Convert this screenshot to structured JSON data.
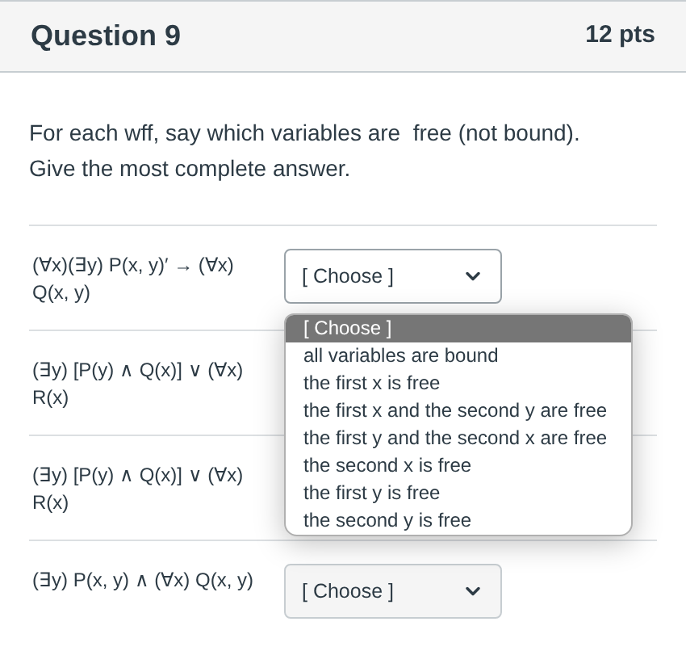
{
  "header": {
    "title": "Question 9",
    "points": "12 pts"
  },
  "instructions": [
    "For each wff, say which variables are  free (not bound).",
    "Give the most complete answer."
  ],
  "rows": [
    {
      "formula": "(∀x)(∃y) P(x, y)′ → (∀x) Q(x, y)",
      "select": {
        "value": "[ Choose ]",
        "expanded": true
      }
    },
    {
      "formula": "(∃y) [P(y) ∧ Q(x)] ∨ (∀x) R(x)"
    },
    {
      "formula": "(∃y) [P(y) ∧ Q(x)] ∨ (∀x) R(x)"
    },
    {
      "formula": "(∃y) P(x, y) ∧ (∀x) Q(x, y)",
      "select": {
        "value": "[ Choose ]",
        "expanded": false
      }
    }
  ],
  "dropdown": {
    "options": [
      {
        "label": "[ Choose ]",
        "selected": true
      },
      {
        "label": "all variables are bound",
        "selected": false
      },
      {
        "label": "the first x is free",
        "selected": false
      },
      {
        "label": "the first x and the second y are free",
        "selected": false
      },
      {
        "label": "the first y and the second x are free",
        "selected": false
      },
      {
        "label": "the second x is free",
        "selected": false
      },
      {
        "label": "the first y is free",
        "selected": false
      },
      {
        "label": "the second y is free",
        "selected": false
      }
    ]
  }
}
